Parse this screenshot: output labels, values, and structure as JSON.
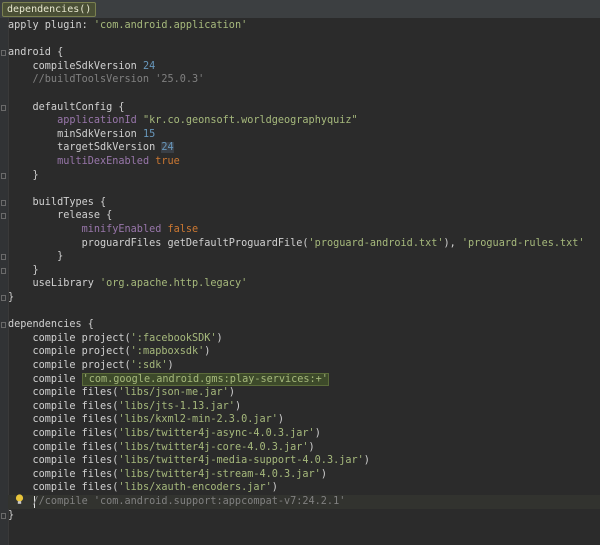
{
  "breadcrumb": "dependencies()",
  "code_lines": [
    [
      [
        "plain",
        "apply plugin: "
      ],
      [
        "str",
        "'com.android.application'"
      ]
    ],
    [],
    [
      [
        "plain",
        "android {"
      ]
    ],
    [
      [
        "plain",
        "    compileSdkVersion "
      ],
      [
        "num",
        "24"
      ]
    ],
    [
      [
        "cmt",
        "    //buildToolsVersion '25.0.3'"
      ]
    ],
    [],
    [
      [
        "plain",
        "    defaultConfig {"
      ]
    ],
    [
      [
        "plain",
        "        "
      ],
      [
        "prop",
        "applicationId "
      ],
      [
        "str",
        "\"kr.co.geonsoft.worldgeographyquiz\""
      ]
    ],
    [
      [
        "plain",
        "        minSdkVersion "
      ],
      [
        "num",
        "15"
      ]
    ],
    [
      [
        "plain",
        "        targetSdkVersion "
      ],
      [
        "numhl",
        "24"
      ]
    ],
    [
      [
        "plain",
        "        "
      ],
      [
        "prop",
        "multiDexEnabled "
      ],
      [
        "kw",
        "true"
      ]
    ],
    [
      [
        "plain",
        "    }"
      ]
    ],
    [],
    [
      [
        "plain",
        "    buildTypes {"
      ]
    ],
    [
      [
        "plain",
        "        release {"
      ]
    ],
    [
      [
        "plain",
        "            "
      ],
      [
        "prop",
        "minifyEnabled "
      ],
      [
        "kw",
        "false"
      ]
    ],
    [
      [
        "plain",
        "            proguardFiles getDefaultProguardFile("
      ],
      [
        "str",
        "'proguard-android.txt'"
      ],
      [
        "plain",
        "), "
      ],
      [
        "str",
        "'proguard-rules.txt'"
      ]
    ],
    [
      [
        "plain",
        "        }"
      ]
    ],
    [
      [
        "plain",
        "    }"
      ]
    ],
    [
      [
        "plain",
        "    useLibrary "
      ],
      [
        "str",
        "'org.apache.http.legacy'"
      ]
    ],
    [
      [
        "plain",
        "}"
      ]
    ],
    [],
    [
      [
        "plain",
        "dependencies {"
      ]
    ],
    [
      [
        "plain",
        "    compile project("
      ],
      [
        "str",
        "':facebookSDK'"
      ],
      [
        "plain",
        ")"
      ]
    ],
    [
      [
        "plain",
        "    compile project("
      ],
      [
        "str",
        "':mapboxsdk'"
      ],
      [
        "plain",
        ")"
      ]
    ],
    [
      [
        "plain",
        "    compile project("
      ],
      [
        "str",
        "':sdk'"
      ],
      [
        "plain",
        ")"
      ]
    ],
    [
      [
        "plain",
        "    compile "
      ],
      [
        "strhl",
        "'com.google.android.gms:play-services:+'"
      ]
    ],
    [
      [
        "plain",
        "    compile files("
      ],
      [
        "str",
        "'libs/json-me.jar'"
      ],
      [
        "plain",
        ")"
      ]
    ],
    [
      [
        "plain",
        "    compile files("
      ],
      [
        "str",
        "'libs/jts-1.13.jar'"
      ],
      [
        "plain",
        ")"
      ]
    ],
    [
      [
        "plain",
        "    compile files("
      ],
      [
        "str",
        "'libs/kxml2-min-2.3.0.jar'"
      ],
      [
        "plain",
        ")"
      ]
    ],
    [
      [
        "plain",
        "    compile files("
      ],
      [
        "str",
        "'libs/twitter4j-async-4.0.3.jar'"
      ],
      [
        "plain",
        ")"
      ]
    ],
    [
      [
        "plain",
        "    compile files("
      ],
      [
        "str",
        "'libs/twitter4j-core-4.0.3.jar'"
      ],
      [
        "plain",
        ")"
      ]
    ],
    [
      [
        "plain",
        "    compile files("
      ],
      [
        "str",
        "'libs/twitter4j-media-support-4.0.3.jar'"
      ],
      [
        "plain",
        ")"
      ]
    ],
    [
      [
        "plain",
        "    compile files("
      ],
      [
        "str",
        "'libs/twitter4j-stream-4.0.3.jar'"
      ],
      [
        "plain",
        ")"
      ]
    ],
    [
      [
        "plain",
        "    compile files("
      ],
      [
        "str",
        "'libs/xauth-encoders.jar'"
      ],
      [
        "plain",
        ")"
      ]
    ],
    [
      [
        "cmt",
        "    //compile 'com.android.support:appcompat-v7:24.2.1'"
      ]
    ],
    [
      [
        "plain",
        "}"
      ]
    ]
  ]
}
